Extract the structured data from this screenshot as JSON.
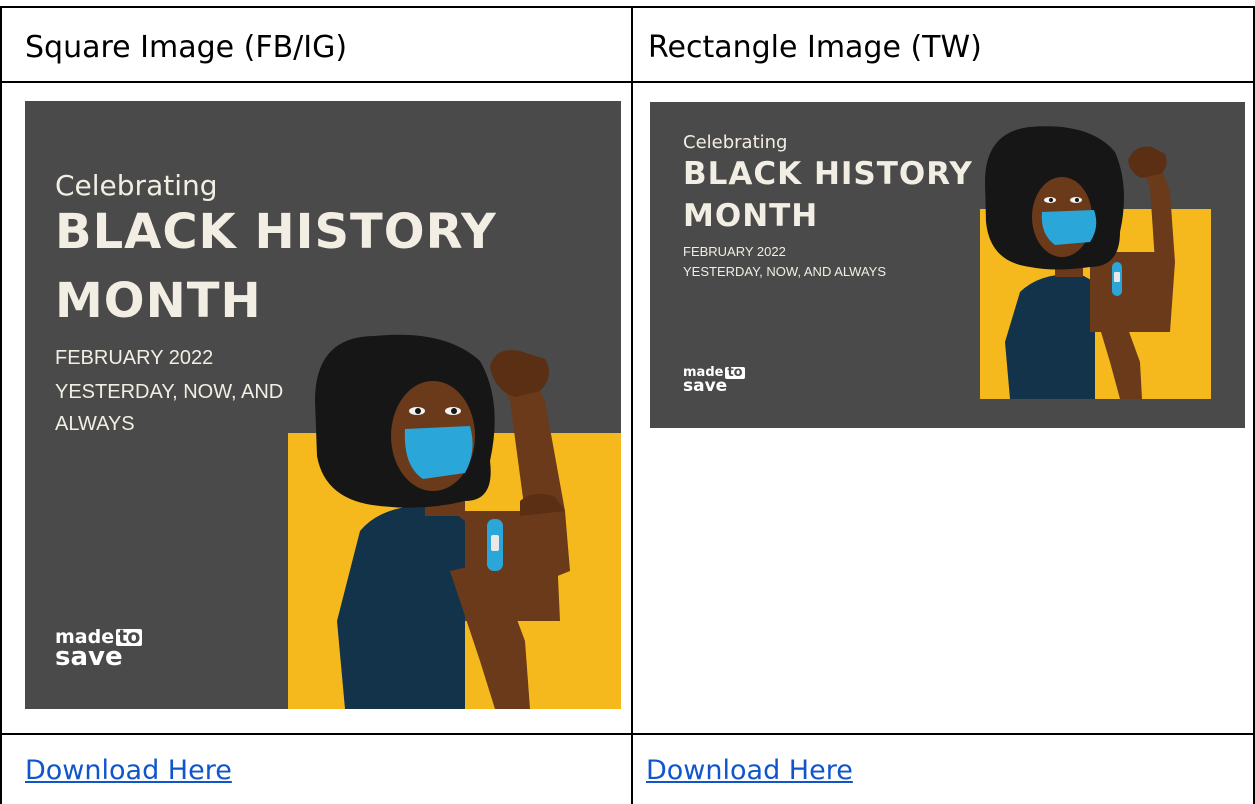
{
  "table": {
    "headers": [
      "Square Image (FB/IG)",
      "Rectangle Image (TW)"
    ],
    "links": [
      "Download Here",
      "Download Here"
    ]
  },
  "graphic": {
    "celebrating": "Celebrating",
    "headline_line1": "BLACK HISTORY",
    "headline_line2": "MONTH",
    "date": "FEBRUARY 2022",
    "tagline_square_line1": "YESTERDAY, NOW, AND",
    "tagline_square_line2": "ALWAYS",
    "tagline_rect": "YESTERDAY, NOW, AND ALWAYS",
    "brand_line1": "made",
    "brand_to": "to",
    "brand_line2": "save"
  },
  "colors": {
    "background": "#4a4a4a",
    "accent": "#f5b91e",
    "text": "#f3eee3",
    "link": "#1155cc",
    "skin": "#6b3a1a",
    "mask": "#2aa6d8",
    "shirt": "#123349",
    "hair": "#161616"
  }
}
